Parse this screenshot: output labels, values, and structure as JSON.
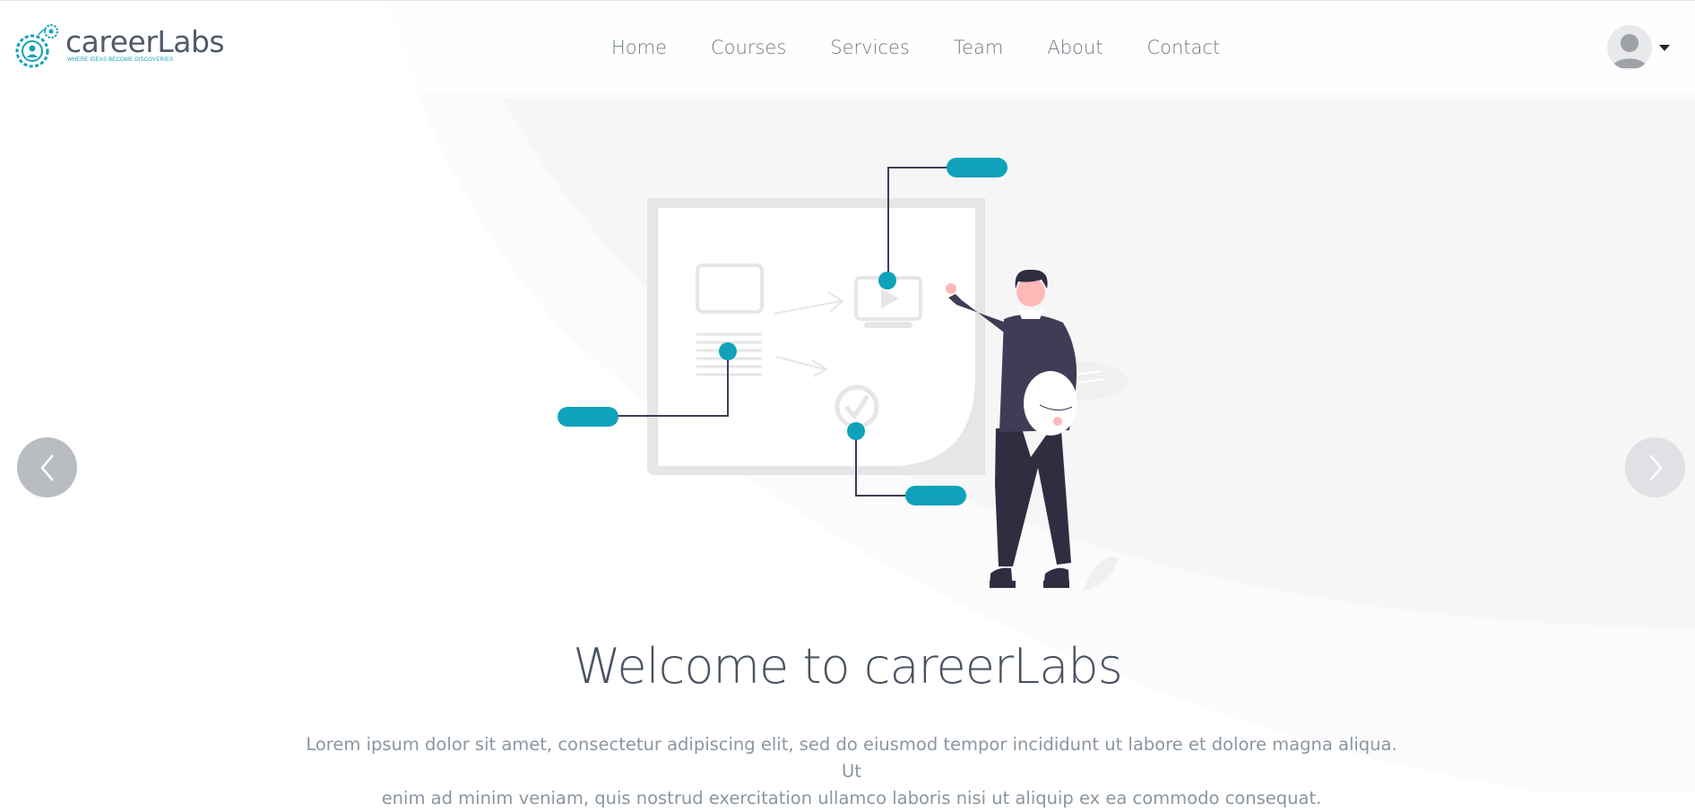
{
  "brand": {
    "name": "careerLabs",
    "tagline": "WHERE IDEAS BECOME DISCOVERIES",
    "accent": "#10a2ba"
  },
  "nav": {
    "items": [
      {
        "label": "Home"
      },
      {
        "label": "Courses"
      },
      {
        "label": "Services"
      },
      {
        "label": "Team"
      },
      {
        "label": "About"
      },
      {
        "label": "Contact"
      }
    ]
  },
  "user_menu": {
    "avatar_icon": "user-avatar-icon",
    "caret_icon": "caret-down-icon"
  },
  "carousel": {
    "prev_icon": "chevron-left-icon",
    "next_icon": "chevron-right-icon"
  },
  "hero": {
    "title": "Welcome to careerLabs",
    "text_line1": "Lorem ipsum dolor sit amet, consectetur adipiscing elit, sed do eiusmod tempor incididunt ut labore et dolore magna aliqua. Ut",
    "text_line2": "enim ad minim veniam, quis nostrud exercitation ullamco laboris nisi ut aliquip ex ea commodo consequat."
  },
  "colors": {
    "accent": "#10a2ba",
    "text_dark": "#4a5360",
    "text_muted": "#8a96a1",
    "figure_dark": "#3f3d56"
  }
}
